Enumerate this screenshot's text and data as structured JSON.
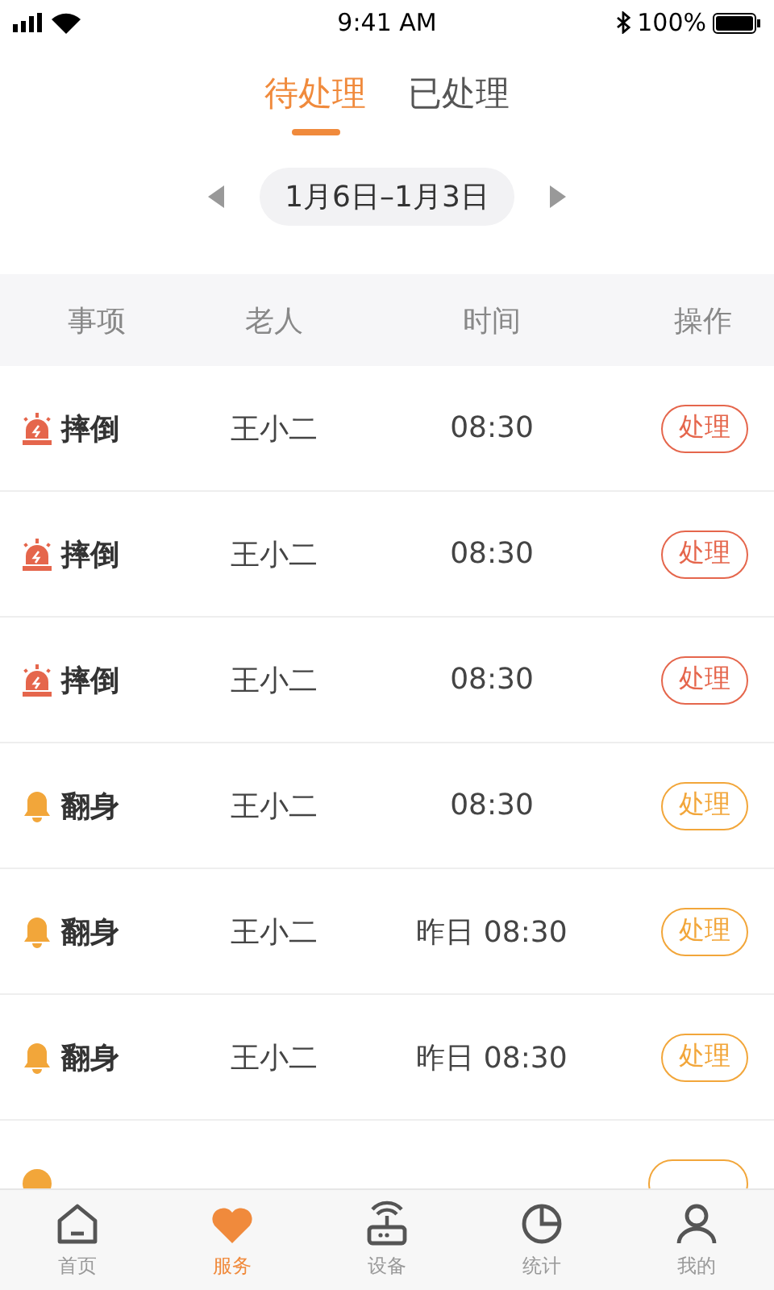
{
  "status_bar": {
    "time": "9:41 AM",
    "battery": "100%"
  },
  "tabs": [
    {
      "label": "待处理",
      "selected": true
    },
    {
      "label": "已处理",
      "selected": false
    }
  ],
  "date_range": {
    "label": "1月6日–1月3日"
  },
  "table": {
    "columns": [
      "事项",
      "老人",
      "时间",
      "操作"
    ],
    "rows": [
      {
        "kind": "fall",
        "item": "摔倒",
        "elder": "王小二",
        "time": "08:30",
        "action": "处理"
      },
      {
        "kind": "fall",
        "item": "摔倒",
        "elder": "王小二",
        "time": "08:30",
        "action": "处理"
      },
      {
        "kind": "fall",
        "item": "摔倒",
        "elder": "王小二",
        "time": "08:30",
        "action": "处理"
      },
      {
        "kind": "turn",
        "item": "翻身",
        "elder": "王小二",
        "time": "08:30",
        "action": "处理"
      },
      {
        "kind": "turn",
        "item": "翻身",
        "elder": "王小二",
        "time": "昨日 08:30",
        "action": "处理"
      },
      {
        "kind": "turn",
        "item": "翻身",
        "elder": "王小二",
        "time": "昨日 08:30",
        "action": "处理"
      },
      {
        "kind": "medicine"
      }
    ]
  },
  "bottom_nav": [
    {
      "kind": "home",
      "label": "首页",
      "selected": false
    },
    {
      "kind": "service",
      "label": "服务",
      "selected": true
    },
    {
      "kind": "device",
      "label": "设备",
      "selected": false
    },
    {
      "kind": "stats",
      "label": "统计",
      "selected": false
    },
    {
      "kind": "mine",
      "label": "我的",
      "selected": false
    }
  ]
}
